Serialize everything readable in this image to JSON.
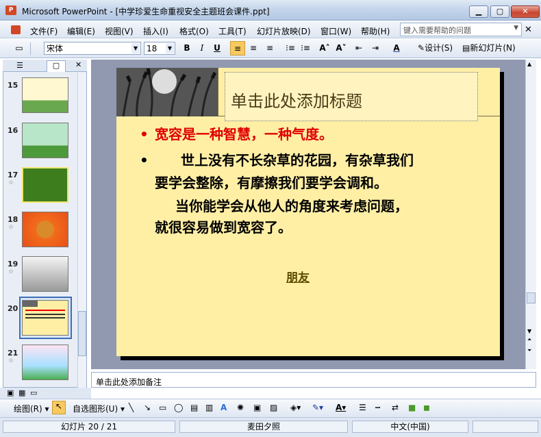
{
  "window": {
    "title": "Microsoft PowerPoint - [中学珍爱生命重视安全主题班会课件.ppt]",
    "app_icon": "P"
  },
  "menu": {
    "items": [
      "文件(F)",
      "编辑(E)",
      "视图(V)",
      "插入(I)",
      "格式(O)",
      "工具(T)",
      "幻灯片放映(D)",
      "窗口(W)",
      "帮助(H)"
    ],
    "help_placeholder": "键入需要帮助的问题"
  },
  "toolbar": {
    "font": "宋体",
    "size": "18",
    "bold": "B",
    "italic": "I",
    "underline": "U",
    "design": "设计(S)",
    "new_slide": "新幻灯片(N)"
  },
  "thumbs": [
    {
      "num": "15"
    },
    {
      "num": "16"
    },
    {
      "num": "17"
    },
    {
      "num": "18"
    },
    {
      "num": "19"
    },
    {
      "num": "20"
    },
    {
      "num": "21"
    }
  ],
  "slide": {
    "title_placeholder": "单击此处添加标题",
    "bullet1": "宽容是一种智慧，一种气度。",
    "bullet2_line1": "世上没有不长杂草的花园，有杂草我们",
    "bullet2_line2": "要学会整除，有摩擦我们要学会调和。",
    "para_line1": "当你能学会从他人的角度来考虑问题，",
    "para_line2": "就很容易做到宽容了。",
    "link": "朋友",
    "colors": {
      "background": "#ffefa5",
      "red": "#e00000"
    }
  },
  "notes": {
    "placeholder": "单击此处添加备注"
  },
  "drawbar": {
    "draw": "绘图(R)",
    "autoshapes": "自选图形(U)"
  },
  "status": {
    "slide": "幻灯片 20 / 21",
    "design": "麦田夕照",
    "lang": "中文(中国)"
  }
}
